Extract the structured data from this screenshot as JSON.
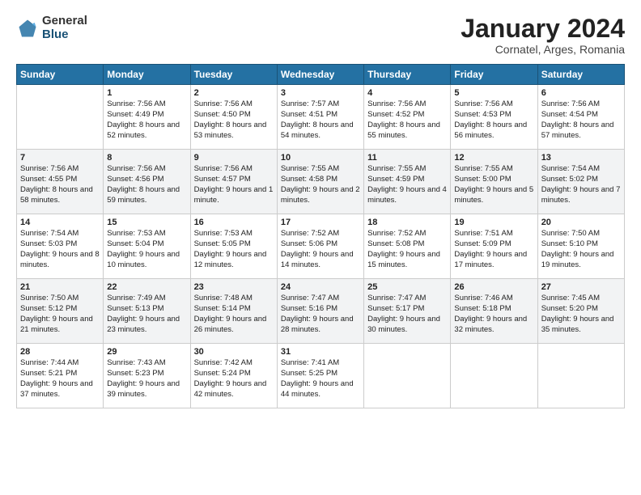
{
  "logo": {
    "general": "General",
    "blue": "Blue"
  },
  "title": "January 2024",
  "subtitle": "Cornatel, Arges, Romania",
  "header_days": [
    "Sunday",
    "Monday",
    "Tuesday",
    "Wednesday",
    "Thursday",
    "Friday",
    "Saturday"
  ],
  "weeks": [
    [
      {
        "day": "",
        "sunrise": "",
        "sunset": "",
        "daylight": ""
      },
      {
        "day": "1",
        "sunrise": "Sunrise: 7:56 AM",
        "sunset": "Sunset: 4:49 PM",
        "daylight": "Daylight: 8 hours and 52 minutes."
      },
      {
        "day": "2",
        "sunrise": "Sunrise: 7:56 AM",
        "sunset": "Sunset: 4:50 PM",
        "daylight": "Daylight: 8 hours and 53 minutes."
      },
      {
        "day": "3",
        "sunrise": "Sunrise: 7:57 AM",
        "sunset": "Sunset: 4:51 PM",
        "daylight": "Daylight: 8 hours and 54 minutes."
      },
      {
        "day": "4",
        "sunrise": "Sunrise: 7:56 AM",
        "sunset": "Sunset: 4:52 PM",
        "daylight": "Daylight: 8 hours and 55 minutes."
      },
      {
        "day": "5",
        "sunrise": "Sunrise: 7:56 AM",
        "sunset": "Sunset: 4:53 PM",
        "daylight": "Daylight: 8 hours and 56 minutes."
      },
      {
        "day": "6",
        "sunrise": "Sunrise: 7:56 AM",
        "sunset": "Sunset: 4:54 PM",
        "daylight": "Daylight: 8 hours and 57 minutes."
      }
    ],
    [
      {
        "day": "7",
        "sunrise": "Sunrise: 7:56 AM",
        "sunset": "Sunset: 4:55 PM",
        "daylight": "Daylight: 8 hours and 58 minutes."
      },
      {
        "day": "8",
        "sunrise": "Sunrise: 7:56 AM",
        "sunset": "Sunset: 4:56 PM",
        "daylight": "Daylight: 8 hours and 59 minutes."
      },
      {
        "day": "9",
        "sunrise": "Sunrise: 7:56 AM",
        "sunset": "Sunset: 4:57 PM",
        "daylight": "Daylight: 9 hours and 1 minute."
      },
      {
        "day": "10",
        "sunrise": "Sunrise: 7:55 AM",
        "sunset": "Sunset: 4:58 PM",
        "daylight": "Daylight: 9 hours and 2 minutes."
      },
      {
        "day": "11",
        "sunrise": "Sunrise: 7:55 AM",
        "sunset": "Sunset: 4:59 PM",
        "daylight": "Daylight: 9 hours and 4 minutes."
      },
      {
        "day": "12",
        "sunrise": "Sunrise: 7:55 AM",
        "sunset": "Sunset: 5:00 PM",
        "daylight": "Daylight: 9 hours and 5 minutes."
      },
      {
        "day": "13",
        "sunrise": "Sunrise: 7:54 AM",
        "sunset": "Sunset: 5:02 PM",
        "daylight": "Daylight: 9 hours and 7 minutes."
      }
    ],
    [
      {
        "day": "14",
        "sunrise": "Sunrise: 7:54 AM",
        "sunset": "Sunset: 5:03 PM",
        "daylight": "Daylight: 9 hours and 8 minutes."
      },
      {
        "day": "15",
        "sunrise": "Sunrise: 7:53 AM",
        "sunset": "Sunset: 5:04 PM",
        "daylight": "Daylight: 9 hours and 10 minutes."
      },
      {
        "day": "16",
        "sunrise": "Sunrise: 7:53 AM",
        "sunset": "Sunset: 5:05 PM",
        "daylight": "Daylight: 9 hours and 12 minutes."
      },
      {
        "day": "17",
        "sunrise": "Sunrise: 7:52 AM",
        "sunset": "Sunset: 5:06 PM",
        "daylight": "Daylight: 9 hours and 14 minutes."
      },
      {
        "day": "18",
        "sunrise": "Sunrise: 7:52 AM",
        "sunset": "Sunset: 5:08 PM",
        "daylight": "Daylight: 9 hours and 15 minutes."
      },
      {
        "day": "19",
        "sunrise": "Sunrise: 7:51 AM",
        "sunset": "Sunset: 5:09 PM",
        "daylight": "Daylight: 9 hours and 17 minutes."
      },
      {
        "day": "20",
        "sunrise": "Sunrise: 7:50 AM",
        "sunset": "Sunset: 5:10 PM",
        "daylight": "Daylight: 9 hours and 19 minutes."
      }
    ],
    [
      {
        "day": "21",
        "sunrise": "Sunrise: 7:50 AM",
        "sunset": "Sunset: 5:12 PM",
        "daylight": "Daylight: 9 hours and 21 minutes."
      },
      {
        "day": "22",
        "sunrise": "Sunrise: 7:49 AM",
        "sunset": "Sunset: 5:13 PM",
        "daylight": "Daylight: 9 hours and 23 minutes."
      },
      {
        "day": "23",
        "sunrise": "Sunrise: 7:48 AM",
        "sunset": "Sunset: 5:14 PM",
        "daylight": "Daylight: 9 hours and 26 minutes."
      },
      {
        "day": "24",
        "sunrise": "Sunrise: 7:47 AM",
        "sunset": "Sunset: 5:16 PM",
        "daylight": "Daylight: 9 hours and 28 minutes."
      },
      {
        "day": "25",
        "sunrise": "Sunrise: 7:47 AM",
        "sunset": "Sunset: 5:17 PM",
        "daylight": "Daylight: 9 hours and 30 minutes."
      },
      {
        "day": "26",
        "sunrise": "Sunrise: 7:46 AM",
        "sunset": "Sunset: 5:18 PM",
        "daylight": "Daylight: 9 hours and 32 minutes."
      },
      {
        "day": "27",
        "sunrise": "Sunrise: 7:45 AM",
        "sunset": "Sunset: 5:20 PM",
        "daylight": "Daylight: 9 hours and 35 minutes."
      }
    ],
    [
      {
        "day": "28",
        "sunrise": "Sunrise: 7:44 AM",
        "sunset": "Sunset: 5:21 PM",
        "daylight": "Daylight: 9 hours and 37 minutes."
      },
      {
        "day": "29",
        "sunrise": "Sunrise: 7:43 AM",
        "sunset": "Sunset: 5:23 PM",
        "daylight": "Daylight: 9 hours and 39 minutes."
      },
      {
        "day": "30",
        "sunrise": "Sunrise: 7:42 AM",
        "sunset": "Sunset: 5:24 PM",
        "daylight": "Daylight: 9 hours and 42 minutes."
      },
      {
        "day": "31",
        "sunrise": "Sunrise: 7:41 AM",
        "sunset": "Sunset: 5:25 PM",
        "daylight": "Daylight: 9 hours and 44 minutes."
      },
      {
        "day": "",
        "sunrise": "",
        "sunset": "",
        "daylight": ""
      },
      {
        "day": "",
        "sunrise": "",
        "sunset": "",
        "daylight": ""
      },
      {
        "day": "",
        "sunrise": "",
        "sunset": "",
        "daylight": ""
      }
    ]
  ]
}
